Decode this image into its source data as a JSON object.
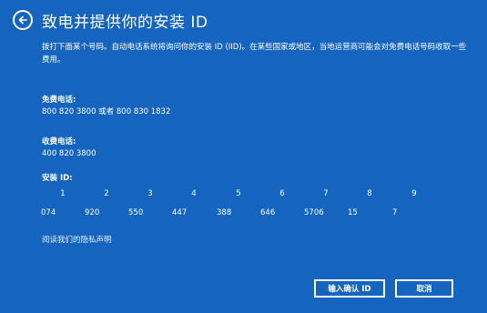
{
  "header": {
    "title": "致电并提供你的安装 ID"
  },
  "description": "拨打下面某个号码。自动电话系统将询问你的安装 ID (IID)。在某些国家或地区，当地运营商可能会对免费电话号码收取一些费用。",
  "free_phone": {
    "label": "免费电话:",
    "value": "800 820 3800 或者 800 830 1832"
  },
  "toll_phone": {
    "label": "收费电话:",
    "value": "400 820 3800"
  },
  "install_id": {
    "label": "安装 ID:",
    "groups": [
      {
        "num": "1",
        "value": "074"
      },
      {
        "num": "2",
        "value": "920"
      },
      {
        "num": "3",
        "value": "550"
      },
      {
        "num": "4",
        "value": "447"
      },
      {
        "num": "5",
        "value": "388"
      },
      {
        "num": "6",
        "value": "646"
      },
      {
        "num": "7",
        "value": "5706"
      },
      {
        "num": "8",
        "value": "15"
      },
      {
        "num": "9",
        "value": "7"
      }
    ]
  },
  "privacy_link": "阅读我们的隐私声明",
  "buttons": {
    "confirm": "输入确认 ID",
    "cancel": "取消"
  },
  "colors": {
    "background": "#1565c0",
    "text": "#ffffff"
  }
}
